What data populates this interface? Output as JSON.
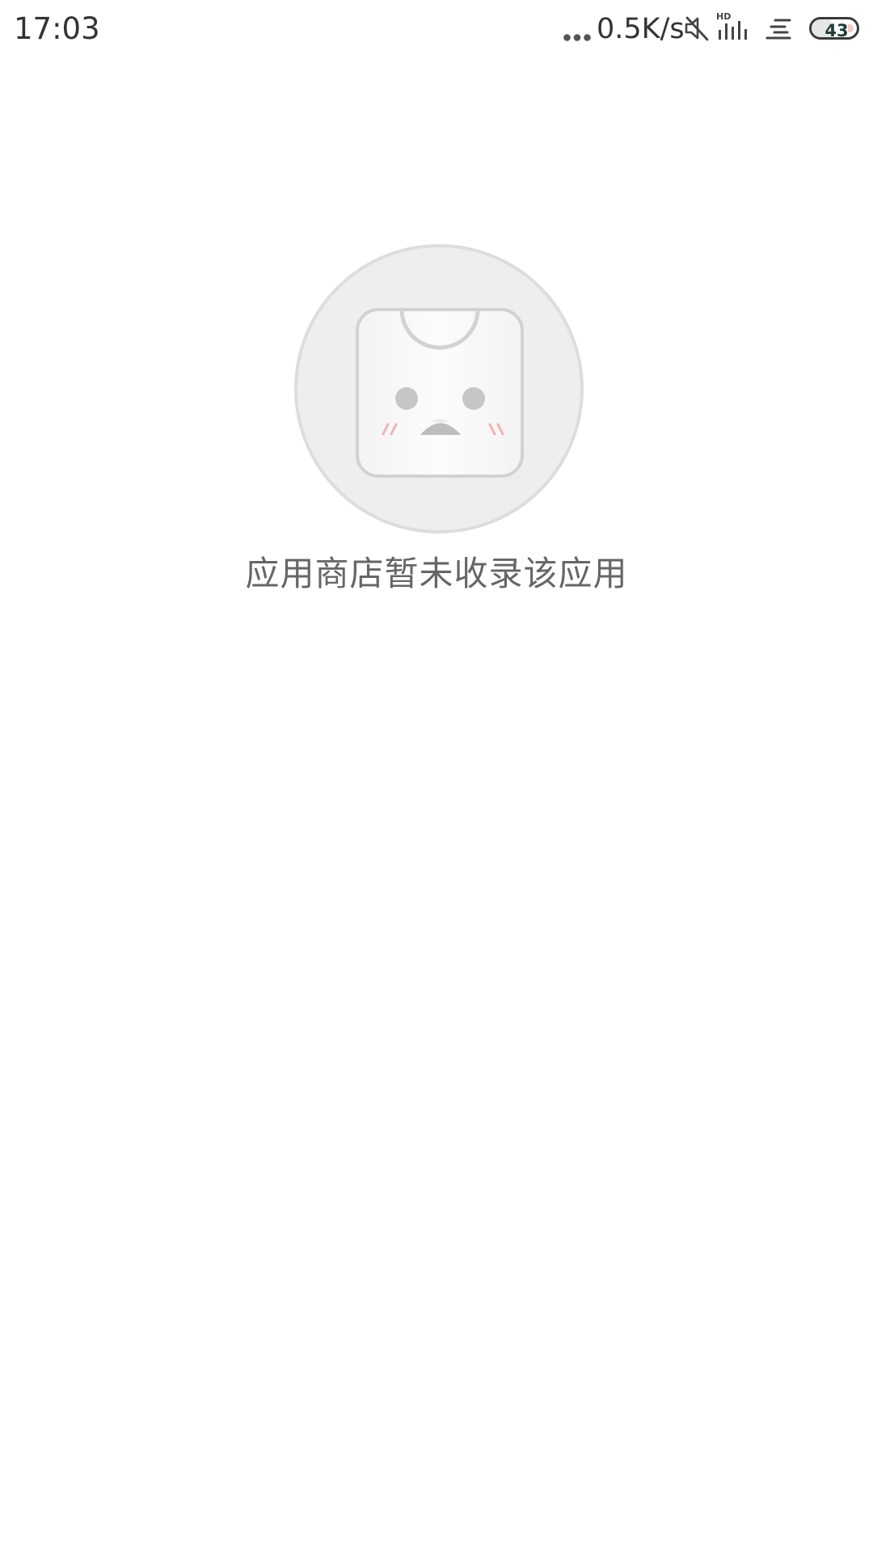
{
  "status_bar": {
    "time": "17:03",
    "network_speed": "0.5K/s",
    "signal_badge": "HD",
    "battery_level": "43",
    "battery_fraction": 0.43,
    "icons": [
      "more-dots-icon",
      "mute-icon",
      "signal-icon",
      "notification-icon",
      "battery-icon"
    ]
  },
  "empty_state": {
    "illustration": "sad-app-store-bag-icon",
    "message": "应用商店暂未收录该应用"
  }
}
